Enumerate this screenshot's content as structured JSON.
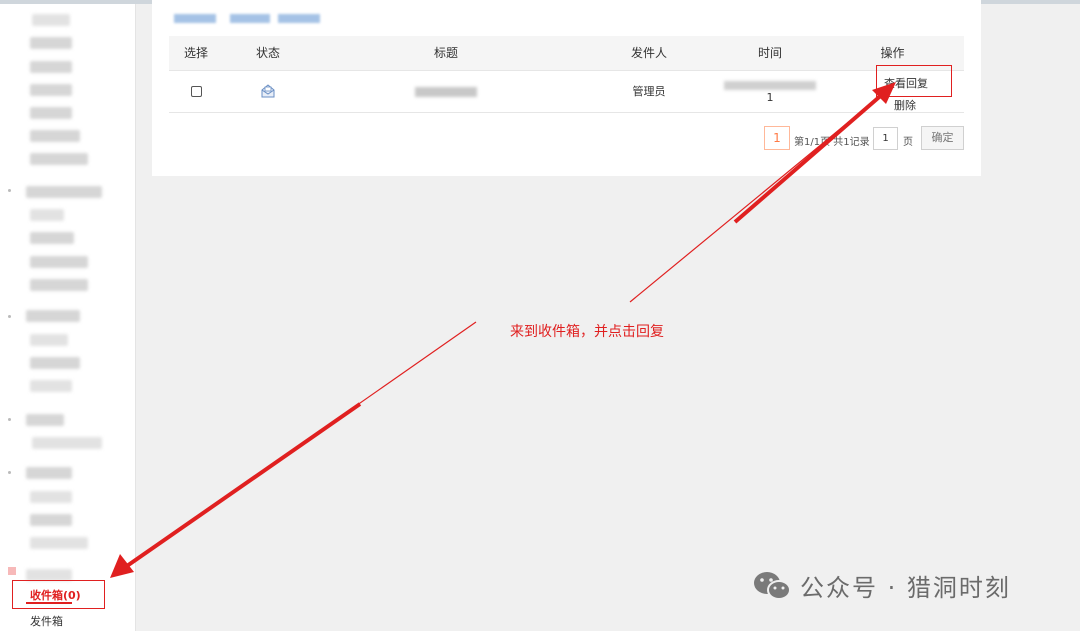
{
  "table": {
    "headers": {
      "select": "选择",
      "status": "状态",
      "title": "标题",
      "sender": "发件人",
      "time": "时间",
      "actions": "操作"
    },
    "rows": [
      {
        "sender": "管理员",
        "time_suffix": "1",
        "action_view": "查看回复",
        "action_delete": "删除"
      }
    ]
  },
  "pagination": {
    "current_page": "1",
    "info": "第1/1页 共1记录",
    "page_input": "1",
    "unit": "页",
    "confirm": "确定"
  },
  "sidebar": {
    "inbox": "收件箱(0)",
    "outbox": "发件箱"
  },
  "annotation": {
    "text": "来到收件箱，并点击回复",
    "color": "#e02020"
  },
  "watermark": {
    "text": "公众号 · 猎洞时刻"
  }
}
